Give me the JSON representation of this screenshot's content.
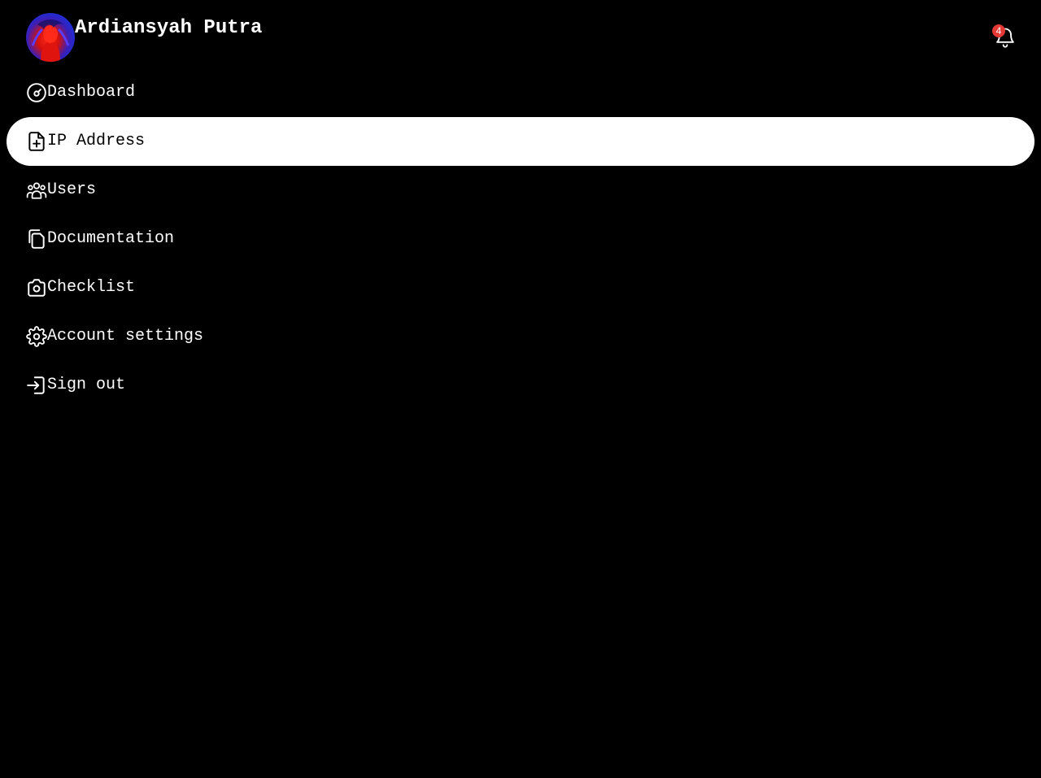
{
  "header": {
    "user_name": "Ardiansyah Putra",
    "notification_count": "4"
  },
  "nav": {
    "active_index": 1,
    "items": [
      {
        "label": "Dashboard",
        "icon": "gauge-icon"
      },
      {
        "label": "IP Address",
        "icon": "file-plus-icon"
      },
      {
        "label": "Users",
        "icon": "users-icon"
      },
      {
        "label": "Documentation",
        "icon": "copy-icon"
      },
      {
        "label": "Checklist",
        "icon": "camera-icon"
      },
      {
        "label": "Account settings",
        "icon": "gear-icon"
      },
      {
        "label": "Sign out",
        "icon": "sign-in-icon"
      }
    ]
  },
  "colors": {
    "background": "#000000",
    "active_item_bg": "#ffffff",
    "badge": "#e53935"
  }
}
